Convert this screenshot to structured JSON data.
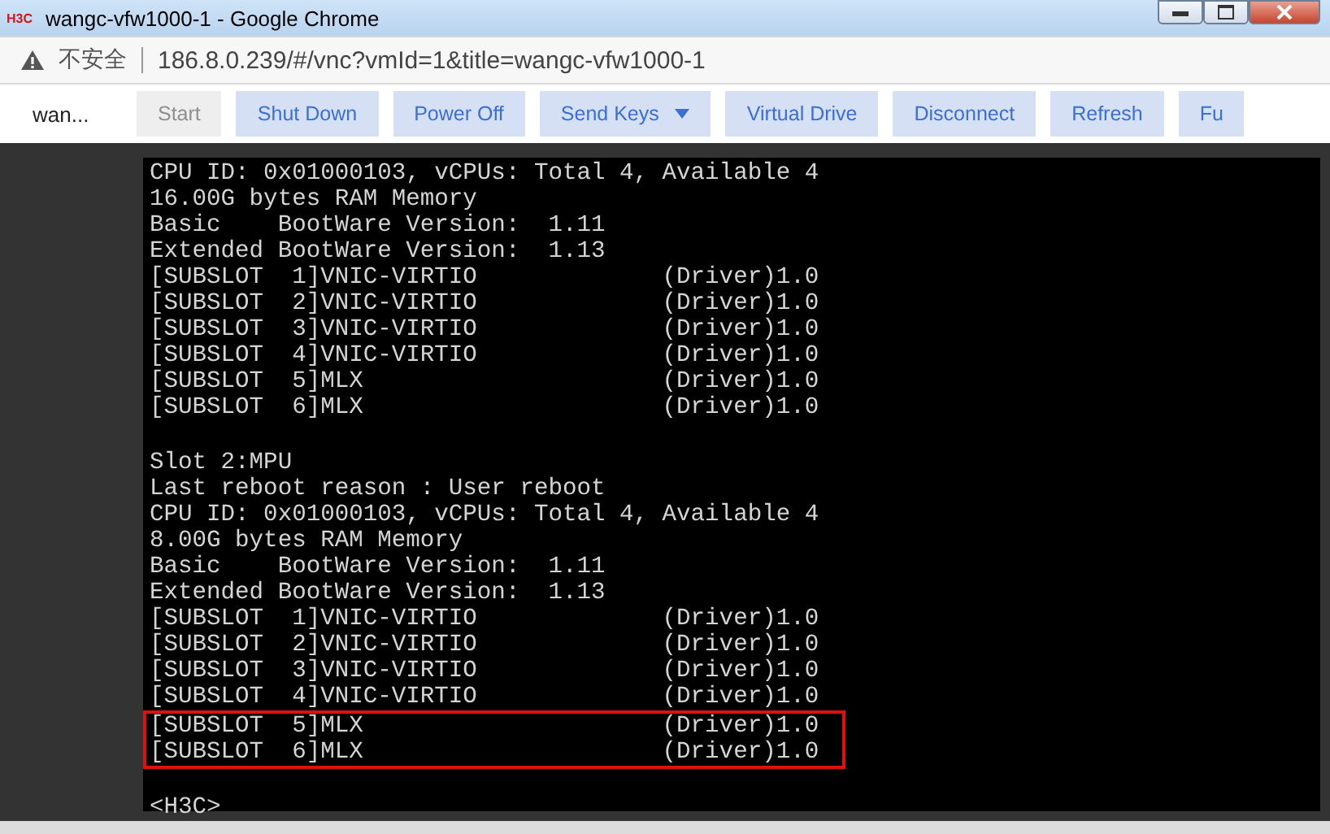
{
  "window": {
    "logo": "H3C",
    "title": "wangc-vfw1000-1 - Google Chrome"
  },
  "address_bar": {
    "security": "不安全",
    "url": "186.8.0.239/#/vnc?vmId=1&title=wangc-vfw1000-1"
  },
  "toolbar": {
    "name": "wan...",
    "buttons": [
      {
        "label": "Start",
        "disabled": true,
        "dropdown": false
      },
      {
        "label": "Shut Down",
        "disabled": false,
        "dropdown": false
      },
      {
        "label": "Power Off",
        "disabled": false,
        "dropdown": false
      },
      {
        "label": "Send Keys",
        "disabled": false,
        "dropdown": true
      },
      {
        "label": "Virtual Drive",
        "disabled": false,
        "dropdown": false
      },
      {
        "label": "Disconnect",
        "disabled": false,
        "dropdown": false
      },
      {
        "label": "Refresh",
        "disabled": false,
        "dropdown": false
      },
      {
        "label": "Fu",
        "disabled": false,
        "dropdown": false
      }
    ]
  },
  "console": {
    "blocks": [
      {
        "highlighted": false,
        "lines": [
          "CPU ID: 0x01000103, vCPUs: Total 4, Available 4",
          "16.00G bytes RAM Memory",
          "Basic    BootWare Version:  1.11",
          "Extended BootWare Version:  1.13",
          "[SUBSLOT  1]VNIC-VIRTIO             (Driver)1.0",
          "[SUBSLOT  2]VNIC-VIRTIO             (Driver)1.0",
          "[SUBSLOT  3]VNIC-VIRTIO             (Driver)1.0",
          "[SUBSLOT  4]VNIC-VIRTIO             (Driver)1.0",
          "[SUBSLOT  5]MLX                     (Driver)1.0",
          "[SUBSLOT  6]MLX                     (Driver)1.0"
        ]
      },
      {
        "highlighted": false,
        "lines": [
          "Slot 2:MPU",
          "Last reboot reason : User reboot",
          "CPU ID: 0x01000103, vCPUs: Total 4, Available 4",
          "8.00G bytes RAM Memory",
          "Basic    BootWare Version:  1.11",
          "Extended BootWare Version:  1.13",
          "[SUBSLOT  1]VNIC-VIRTIO             (Driver)1.0",
          "[SUBSLOT  2]VNIC-VIRTIO             (Driver)1.0",
          "[SUBSLOT  3]VNIC-VIRTIO             (Driver)1.0",
          "[SUBSLOT  4]VNIC-VIRTIO             (Driver)1.0"
        ]
      },
      {
        "highlighted": true,
        "lines": [
          "[SUBSLOT  5]MLX                     (Driver)1.0",
          "[SUBSLOT  6]MLX                     (Driver)1.0"
        ]
      },
      {
        "highlighted": false,
        "lines": [
          "<H3C>"
        ]
      }
    ]
  }
}
